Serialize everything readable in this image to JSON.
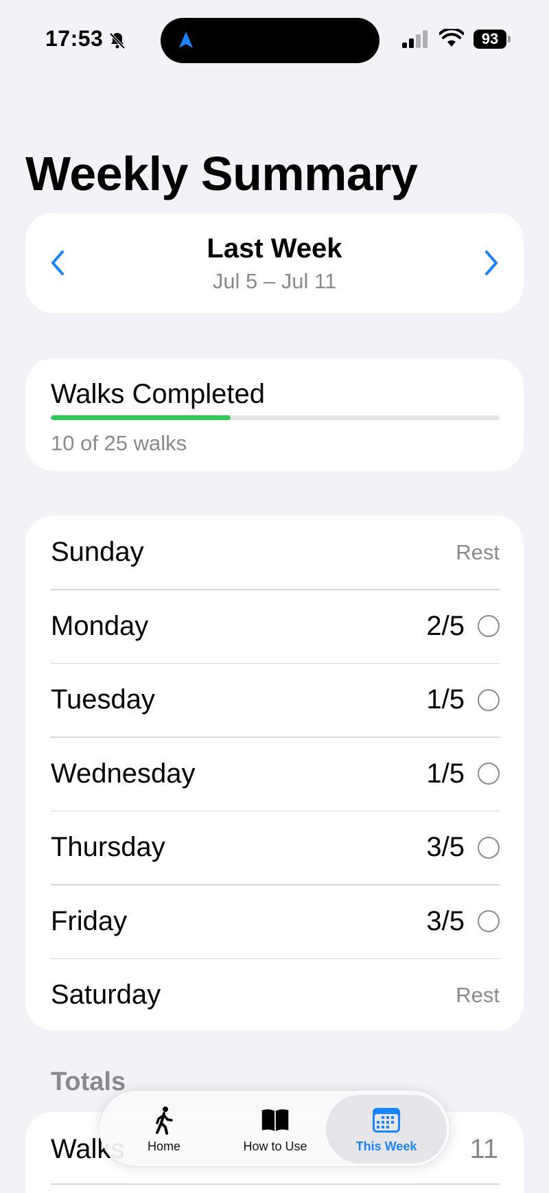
{
  "status_bar": {
    "time": "17:53",
    "battery": "93",
    "icons": [
      "bell-slash-icon",
      "location-arrow-icon",
      "cellular-signal-icon",
      "wifi-icon",
      "battery-icon"
    ]
  },
  "page": {
    "title": "Weekly Summary"
  },
  "week_selector": {
    "title": "Last Week",
    "range": "Jul 5 – Jul 11",
    "prev_icon": "chevron-left-icon",
    "next_icon": "chevron-right-icon"
  },
  "walks": {
    "label": "Walks Completed",
    "summary": "10 of 25 walks",
    "completed": 10,
    "total": 25
  },
  "days": [
    {
      "name": "Sunday",
      "value": "Rest",
      "rest": true
    },
    {
      "name": "Monday",
      "value": "2/5",
      "rest": false
    },
    {
      "name": "Tuesday",
      "value": "1/5",
      "rest": false
    },
    {
      "name": "Wednesday",
      "value": "1/5",
      "rest": false
    },
    {
      "name": "Thursday",
      "value": "3/5",
      "rest": false
    },
    {
      "name": "Friday",
      "value": "3/5",
      "rest": false
    },
    {
      "name": "Saturday",
      "value": "Rest",
      "rest": true
    }
  ],
  "totals": {
    "header": "Totals",
    "rows": [
      {
        "label": "Walks",
        "value": "11"
      }
    ]
  },
  "tab_bar": {
    "tabs": [
      {
        "label": "Home",
        "icon": "walking-figure-icon",
        "selected": false
      },
      {
        "label": "How to Use",
        "icon": "book-icon",
        "selected": false
      },
      {
        "label": "This Week",
        "icon": "calendar-icon",
        "selected": true
      }
    ]
  },
  "colors": {
    "accent": "#1a84ff",
    "progress": "#34c759",
    "secondary_text": "#8a8a8e",
    "background": "#f2f2f7"
  }
}
